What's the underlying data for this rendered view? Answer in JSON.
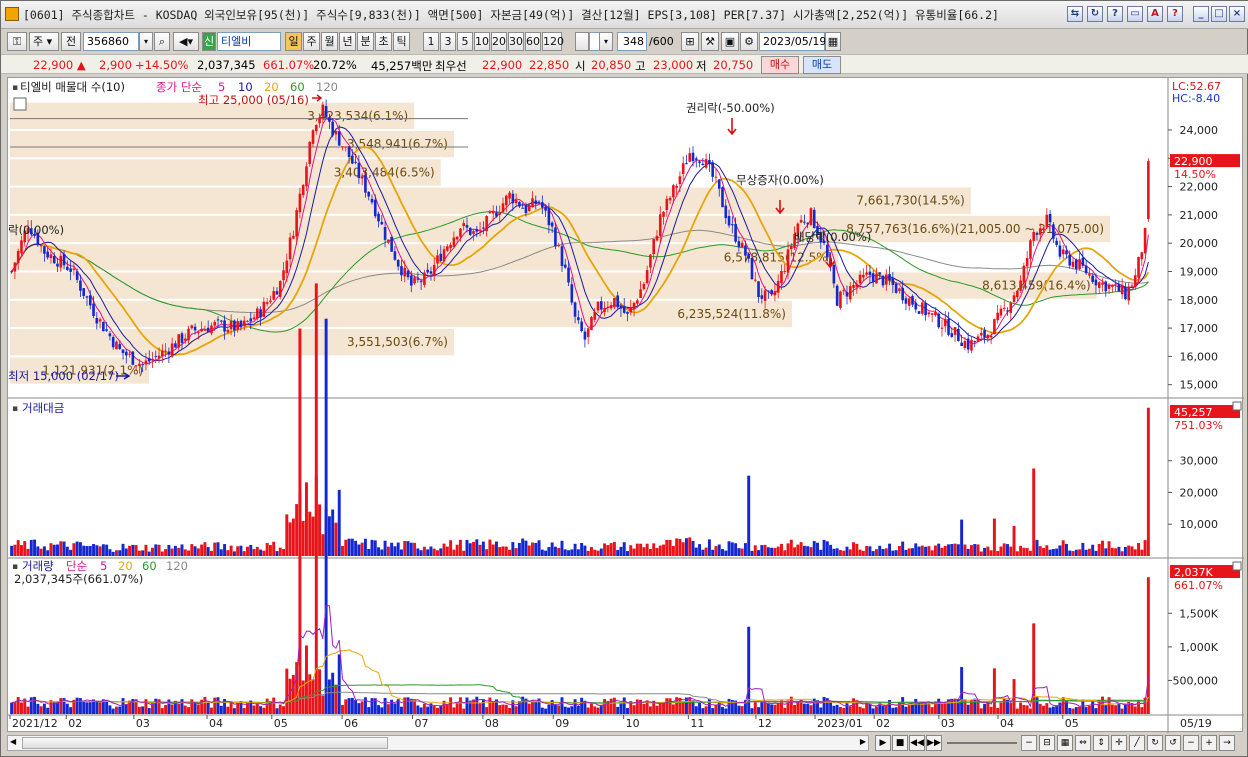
{
  "window": {
    "title": "[0601] 주식종합차트 - KOSDAQ 외국인보유[95(천)] 주식수[9,833(천)] 액면[500] 자본금[49(억)] 결산[12월] EPS[3,108] PER[7.37] 시가총액[2,252(억)] 유통비율[66.2]"
  },
  "toolbar": {
    "type_select": "주",
    "market_label": "전",
    "code": "356860",
    "credit_badge": "신",
    "stock_name": "티엘비",
    "periods": [
      "일",
      "주",
      "월",
      "년",
      "분",
      "초",
      "틱"
    ],
    "intervals": [
      "1",
      "3",
      "5",
      "10",
      "20",
      "30",
      "60",
      "120"
    ],
    "count": "348",
    "count_total": "/600",
    "date": "2023/05/19"
  },
  "pricebar": {
    "price": "22,900",
    "change": "2,900",
    "change_pct": "+14.50%",
    "volume": "2,037,345",
    "vol_ratio": "661.07%",
    "turnover": "20.72%",
    "amount": "45,257백만",
    "best_label": "최우선",
    "best_ask": "22,900",
    "best_bid": "22,850",
    "open_label": "시",
    "open": "20,850",
    "high_label": "고",
    "high": "23,000",
    "low_label": "저",
    "low": "20,750",
    "buy_label": "매수",
    "sell_label": "매도"
  },
  "chart": {
    "main_legend": "티엘비 매물대 수(10)",
    "ma_label": "종가 단순",
    "ma_periods": [
      "5",
      "10",
      "20",
      "60",
      "120"
    ],
    "lc": "LC:52.67",
    "hc": "HC:-8.40",
    "high_marker": "최고 25,000 (05/16)",
    "low_marker": "최저 15,000 (02/17)",
    "price_ticks": [
      "24,000",
      "23,000",
      "22,000",
      "21,000",
      "20,000",
      "19,000",
      "18,000",
      "17,000",
      "16,000",
      "15,000"
    ],
    "price_tag": "22,900",
    "price_tag_pct": "14.50%",
    "events": [
      "권리락(-50.00%)",
      "무상증자(0.00%)",
      "락(0.00%)",
      "배당락(0.00%)"
    ],
    "volume_profile": [
      "3,423,534(6.1%)",
      "3,548,941(6.7%)",
      "3,403,484(6.5%)",
      "7,661,730(14.5%)",
      "8,757,763(16.6%)(21,005.00 ~ 21,075.00)",
      "6,578,815(12.5%)",
      "8,613,459(16.4%)",
      "6,235,524(11.8%)",
      "3,551,503(6.7%)",
      "1,121,931(2.1%)"
    ],
    "amount_panel": {
      "title": "거래대금",
      "ticks": [
        "30,000",
        "20,000",
        "10,000"
      ],
      "tag": "45,257",
      "tag_pct": "751.03%"
    },
    "volume_panel": {
      "title": "거래량",
      "ma_label": "단순",
      "ma_periods": [
        "5",
        "20",
        "60",
        "120"
      ],
      "value_text": "2,037,345주(661.07%)",
      "ticks": [
        "1,500K",
        "1,000K",
        "500,000"
      ],
      "tag": "2,037K",
      "tag_pct": "661.07%"
    },
    "x_ticks": [
      "2021/12",
      "02",
      "03",
      "04",
      "05",
      "06",
      "07",
      "08",
      "09",
      "10",
      "11",
      "12",
      "2023/01",
      "02",
      "03",
      "04",
      "05",
      "05/19"
    ]
  },
  "colors": {
    "up": "#e8141a",
    "down": "#1428d0",
    "ma5": "#e0148c",
    "ma10": "#1a1aa0",
    "ma20": "#e6a50a",
    "ma60": "#2a9a2a",
    "ma120": "#8a8a8a",
    "profile": "#f4e6d2"
  },
  "chart_data": {
    "type": "candlestick",
    "y_range_price": [
      15000,
      25000
    ],
    "key_points": [
      {
        "label": "최고",
        "date": "05/16",
        "price": 25000
      },
      {
        "label": "최저",
        "date": "02/17",
        "price": 15000
      },
      {
        "label": "current",
        "date": "2023/05/19",
        "open": 20850,
        "high": 23000,
        "low": 20750,
        "close": 22900
      }
    ]
  }
}
